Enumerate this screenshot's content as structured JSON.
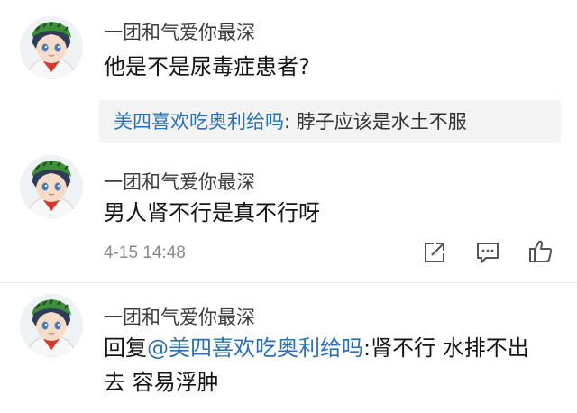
{
  "comments": [
    {
      "username": "一团和气爱你最深",
      "text": "他是不是尿毒症患者?",
      "quote": {
        "author": "美四喜欢吃奥利给吗",
        "separator": ": ",
        "text": "脖子应该是水土不服"
      }
    },
    {
      "username": "一团和气爱你最深",
      "text": "男人肾不行是真不行呀",
      "timestamp": "4-15 14:48"
    },
    {
      "username": "一团和气爱你最深",
      "reply_prefix": "回复",
      "mention": "@美四喜欢吃奥利给吗",
      "text_line1": ":肾不行 水排不出",
      "text_line2": "去 容易浮肿"
    }
  ],
  "icons": {
    "share": "share-icon",
    "comment": "comment-icon",
    "like": "thumbs-up-icon"
  },
  "colors": {
    "link": "#2d6fb6",
    "quote_bg": "#f3f3f3",
    "muted": "#8a8a8a"
  }
}
